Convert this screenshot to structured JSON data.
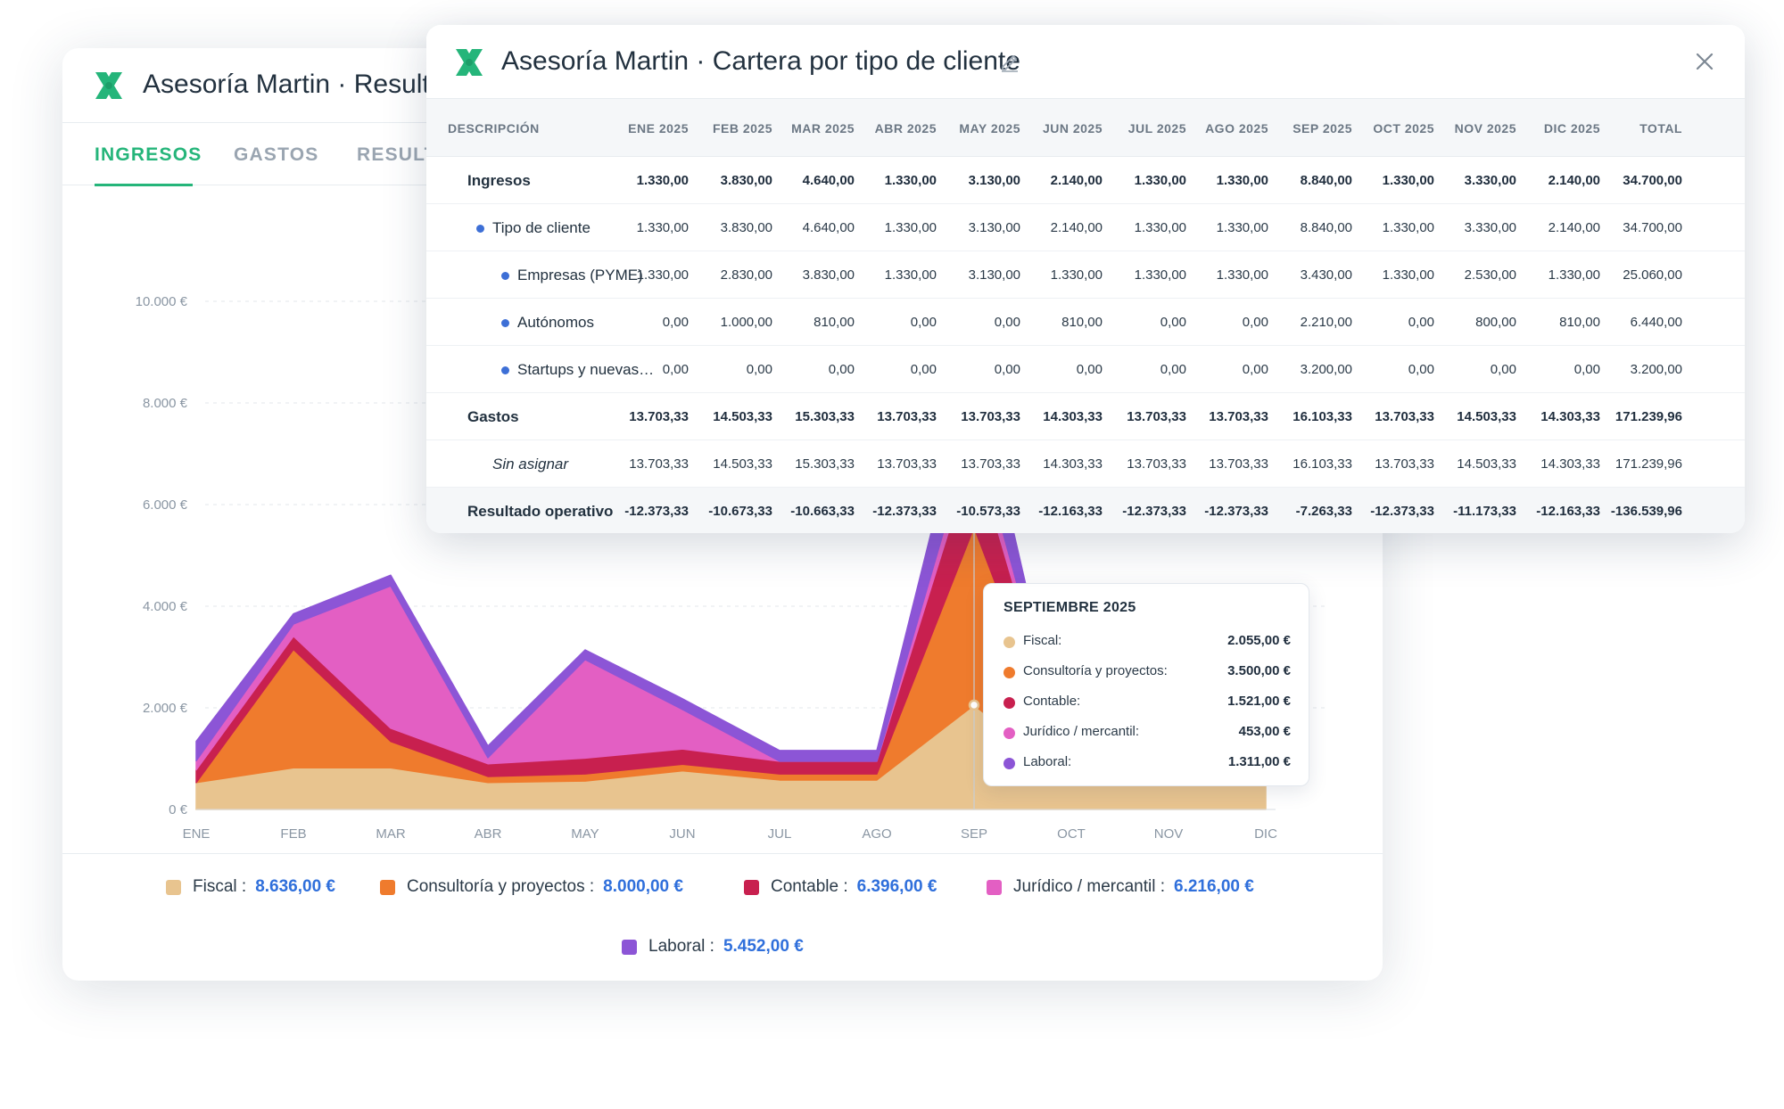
{
  "back_window": {
    "title": "Asesoría Martin · Resulta",
    "tabs": [
      {
        "label": "INGRESOS",
        "active": true
      },
      {
        "label": "GASTOS",
        "active": false
      },
      {
        "label": "RESULTA",
        "active": false
      }
    ]
  },
  "chart_data": {
    "type": "area",
    "stacked": true,
    "categories": [
      "ENE",
      "FEB",
      "MAR",
      "ABR",
      "MAY",
      "JUN",
      "JUL",
      "AGO",
      "SEP",
      "OCT",
      "NOV",
      "DIC"
    ],
    "y_ticks": [
      "0 €",
      "2.000 €",
      "4.000 €",
      "6.000 €",
      "8.000 €",
      "10.000 €"
    ],
    "ylim": [
      0,
      10000
    ],
    "grid": true,
    "series": [
      {
        "name": "Fiscal",
        "color": "#e8c48f",
        "values": [
          530,
          820,
          820,
          530,
          560,
          760,
          580,
          580,
          2055,
          530,
          530,
          530
        ]
      },
      {
        "name": "Consultoría y proyectos",
        "color": "#ef7b2d",
        "values": [
          0,
          2330,
          520,
          120,
          140,
          130,
          120,
          120,
          3500,
          0,
          0,
          0
        ]
      },
      {
        "name": "Contable",
        "color": "#c8204f",
        "values": [
          250,
          260,
          260,
          250,
          310,
          300,
          250,
          250,
          1521,
          0,
          0,
          0
        ]
      },
      {
        "name": "Jurídico / mercantil",
        "color": "#e35fc3",
        "values": [
          180,
          240,
          2800,
          120,
          1940,
          780,
          0,
          0,
          453,
          0,
          0,
          0
        ]
      },
      {
        "name": "Laboral",
        "color": "#8c55d6",
        "values": [
          380,
          200,
          210,
          230,
          190,
          210,
          210,
          210,
          1311,
          0,
          0,
          0
        ]
      }
    ],
    "legend": [
      {
        "label": "Fiscal :",
        "value": "8.636,00 €",
        "color": "#e8c48f"
      },
      {
        "label": "Consultoría y proyectos :",
        "value": "8.000,00 €",
        "color": "#ef7b2d"
      },
      {
        "label": "Contable :",
        "value": "6.396,00 €",
        "color": "#c8204f"
      },
      {
        "label": "Jurídico / mercantil :",
        "value": "6.216,00 €",
        "color": "#e35fc3"
      },
      {
        "label": "Laboral :",
        "value": "5.452,00 €",
        "color": "#8c55d6"
      }
    ],
    "tooltip": {
      "title": "SEPTIEMBRE 2025",
      "rows": [
        {
          "label": "Fiscal:",
          "value": "2.055,00 €",
          "color": "#e8c48f"
        },
        {
          "label": "Consultoría y proyectos:",
          "value": "3.500,00 €",
          "color": "#ef7b2d"
        },
        {
          "label": "Contable:",
          "value": "1.521,00 €",
          "color": "#c8204f"
        },
        {
          "label": "Jurídico / mercantil:",
          "value": "453,00 €",
          "color": "#e35fc3"
        },
        {
          "label": "Laboral:",
          "value": "1.311,00 €",
          "color": "#8c55d6"
        }
      ]
    }
  },
  "front_window": {
    "title": "Asesoría Martin · Cartera por tipo de cliente",
    "table": {
      "columns": [
        "DESCRIPCIÓN",
        "ENE 2025",
        "FEB 2025",
        "MAR 2025",
        "ABR 2025",
        "MAY 2025",
        "JUN 2025",
        "JUL 2025",
        "AGO 2025",
        "SEP 2025",
        "OCT 2025",
        "NOV 2025",
        "DIC 2025",
        "TOTAL"
      ],
      "rows": [
        {
          "label": "Ingresos",
          "level": 0,
          "style": "bold",
          "bullet": false,
          "values": [
            "1.330,00",
            "3.830,00",
            "4.640,00",
            "1.330,00",
            "3.130,00",
            "2.140,00",
            "1.330,00",
            "1.330,00",
            "8.840,00",
            "1.330,00",
            "3.330,00",
            "2.140,00",
            "34.700,00"
          ]
        },
        {
          "label": "Tipo de cliente",
          "level": 1,
          "style": "normal",
          "bullet": true,
          "values": [
            "1.330,00",
            "3.830,00",
            "4.640,00",
            "1.330,00",
            "3.130,00",
            "2.140,00",
            "1.330,00",
            "1.330,00",
            "8.840,00",
            "1.330,00",
            "3.330,00",
            "2.140,00",
            "34.700,00"
          ]
        },
        {
          "label": "Empresas (PYME)",
          "level": 2,
          "style": "normal",
          "bullet": true,
          "values": [
            "1.330,00",
            "2.830,00",
            "3.830,00",
            "1.330,00",
            "3.130,00",
            "1.330,00",
            "1.330,00",
            "1.330,00",
            "3.430,00",
            "1.330,00",
            "2.530,00",
            "1.330,00",
            "25.060,00"
          ]
        },
        {
          "label": "Autónomos",
          "level": 2,
          "style": "normal",
          "bullet": true,
          "values": [
            "0,00",
            "1.000,00",
            "810,00",
            "0,00",
            "0,00",
            "810,00",
            "0,00",
            "0,00",
            "2.210,00",
            "0,00",
            "800,00",
            "810,00",
            "6.440,00"
          ]
        },
        {
          "label": "Startups y nuevas…",
          "level": 2,
          "style": "normal",
          "bullet": true,
          "values": [
            "0,00",
            "0,00",
            "0,00",
            "0,00",
            "0,00",
            "0,00",
            "0,00",
            "0,00",
            "3.200,00",
            "0,00",
            "0,00",
            "0,00",
            "3.200,00"
          ]
        },
        {
          "label": "Gastos",
          "level": 0,
          "style": "bold",
          "bullet": false,
          "values": [
            "13.703,33",
            "14.503,33",
            "15.303,33",
            "13.703,33",
            "13.703,33",
            "14.303,33",
            "13.703,33",
            "13.703,33",
            "16.103,33",
            "13.703,33",
            "14.503,33",
            "14.303,33",
            "171.239,96"
          ]
        },
        {
          "label": "Sin asignar",
          "level": 1,
          "style": "italic",
          "bullet": false,
          "values": [
            "13.703,33",
            "14.503,33",
            "15.303,33",
            "13.703,33",
            "13.703,33",
            "14.303,33",
            "13.703,33",
            "13.703,33",
            "16.103,33",
            "13.703,33",
            "14.503,33",
            "14.303,33",
            "171.239,96"
          ]
        },
        {
          "label": "Resultado operativo",
          "level": 0,
          "style": "bold",
          "bullet": false,
          "values": [
            "-12.373,33",
            "-10.673,33",
            "-10.663,33",
            "-12.373,33",
            "-10.573,33",
            "-12.163,33",
            "-12.373,33",
            "-12.373,33",
            "-7.263,33",
            "-12.373,33",
            "-11.173,33",
            "-12.163,33",
            "-136.539,96"
          ]
        }
      ]
    }
  },
  "colors": {
    "accent": "#25b57a",
    "link_value": "#2f6fdb",
    "bullet": "#3d6fd6"
  }
}
